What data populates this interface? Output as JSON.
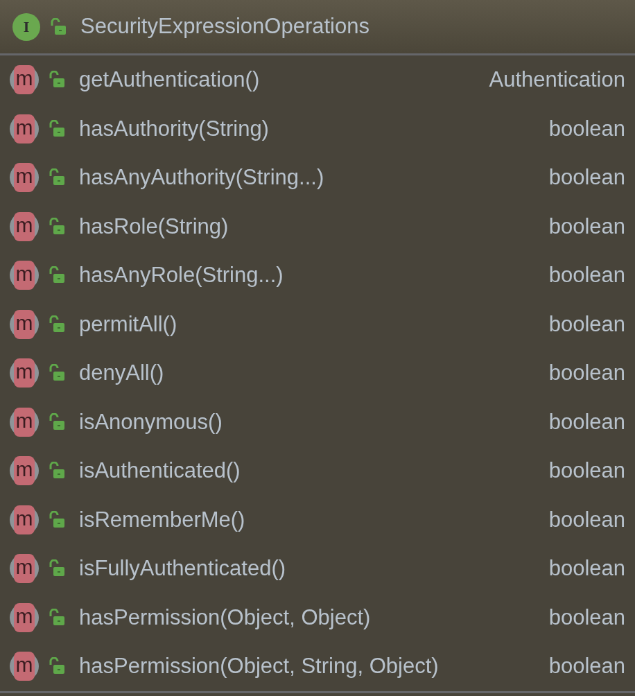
{
  "header": {
    "icon_letter": "I",
    "title": "SecurityExpressionOperations"
  },
  "methods": [
    {
      "icon_letter": "m",
      "name": "getAuthentication()",
      "type": "Authentication"
    },
    {
      "icon_letter": "m",
      "name": "hasAuthority(String)",
      "type": "boolean"
    },
    {
      "icon_letter": "m",
      "name": "hasAnyAuthority(String...)",
      "type": "boolean"
    },
    {
      "icon_letter": "m",
      "name": "hasRole(String)",
      "type": "boolean"
    },
    {
      "icon_letter": "m",
      "name": "hasAnyRole(String...)",
      "type": "boolean"
    },
    {
      "icon_letter": "m",
      "name": "permitAll()",
      "type": "boolean"
    },
    {
      "icon_letter": "m",
      "name": "denyAll()",
      "type": "boolean"
    },
    {
      "icon_letter": "m",
      "name": "isAnonymous()",
      "type": "boolean"
    },
    {
      "icon_letter": "m",
      "name": "isAuthenticated()",
      "type": "boolean"
    },
    {
      "icon_letter": "m",
      "name": "isRememberMe()",
      "type": "boolean"
    },
    {
      "icon_letter": "m",
      "name": "isFullyAuthenticated()",
      "type": "boolean"
    },
    {
      "icon_letter": "m",
      "name": "hasPermission(Object, Object)",
      "type": "boolean"
    },
    {
      "icon_letter": "m",
      "name": "hasPermission(Object, String, Object)",
      "type": "boolean"
    }
  ]
}
